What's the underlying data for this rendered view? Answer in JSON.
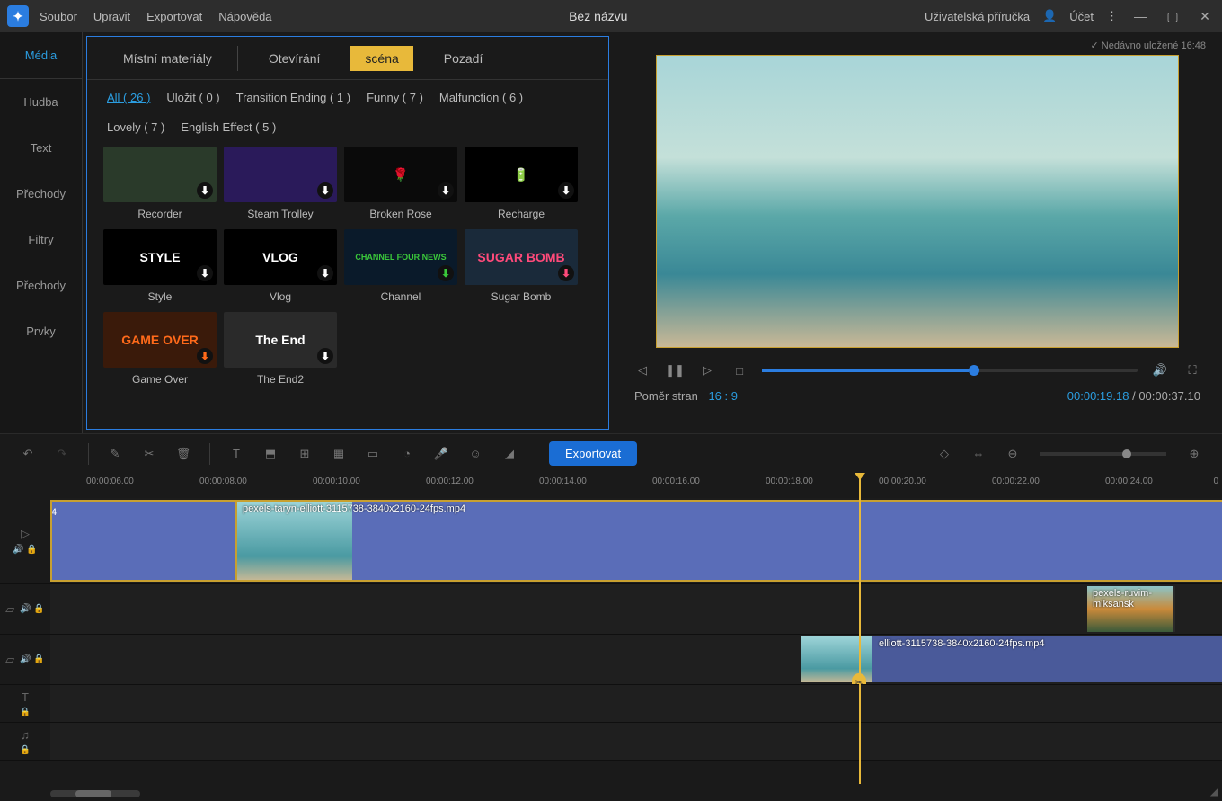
{
  "menu": {
    "file": "Soubor",
    "edit": "Upravit",
    "export": "Exportovat",
    "help": "Nápověda"
  },
  "title": "Bez názvu",
  "right": {
    "guide": "Uživatelská příručka",
    "account": "Účet"
  },
  "save_status": "Nedávno uložené 16:48",
  "sidebar": {
    "media": "Média",
    "music": "Hudba",
    "text": "Text",
    "trans": "Přechody",
    "filters": "Filtry",
    "trans2": "Přechody",
    "elements": "Prvky"
  },
  "tabs": {
    "local": "Místní materiály",
    "opening": "Otevírání",
    "scene": "scéna",
    "bg": "Pozadí"
  },
  "filters": {
    "all": "All ( 26 )",
    "save": "Uložit ( 0 )",
    "transend": "Transition Ending ( 1 )",
    "funny": "Funny ( 7 )",
    "malfunc": "Malfunction ( 6 )",
    "lovely": "Lovely ( 7 )",
    "eng": "English Effect ( 5 )"
  },
  "thumbs": [
    {
      "name": "Recorder",
      "bg": "#2a3a2a",
      "txt": ""
    },
    {
      "name": "Steam  Trolley",
      "bg": "#2a1a5a",
      "txt": ""
    },
    {
      "name": "Broken Rose",
      "bg": "#0a0a0a",
      "txt": "🌹"
    },
    {
      "name": "Recharge",
      "bg": "#000",
      "txt": "🔋"
    },
    {
      "name": "Style",
      "bg": "#000",
      "txt": "STYLE"
    },
    {
      "name": "Vlog",
      "bg": "#000",
      "txt": "VLOG"
    },
    {
      "name": "Channel",
      "bg": "#0a1a2a",
      "txt": "CHANNEL FOUR NEWS"
    },
    {
      "name": "Sugar Bomb",
      "bg": "#1a2a3a",
      "txt": "SUGAR BOMB"
    },
    {
      "name": "Game Over",
      "bg": "#3a1a0a",
      "txt": "GAME OVER"
    },
    {
      "name": "The End2",
      "bg": "#2a2a2a",
      "txt": "The End"
    }
  ],
  "ratio_label": "Poměr stran",
  "ratio_val": "16 : 9",
  "time_cur": "00:00:19.18",
  "time_sep": " /  ",
  "time_total": "00:00:37.10",
  "export_btn": "Exportovat",
  "ruler": [
    "00:00:06.00",
    "00:00:08.00",
    "00:00:10.00",
    "00:00:12.00",
    "00:00:14.00",
    "00:00:16.00",
    "00:00:18.00",
    "00:00:20.00",
    "00:00:22.00",
    "00:00:24.00"
  ],
  "clip1": "pexels-taryn-elliott-3115738-3840x2160-24fps.mp4",
  "clip2": "pexels-ruvim-miksansk",
  "clip3": "elliott-3115738-3840x2160-24fps.mp4",
  "track_marker": "4"
}
